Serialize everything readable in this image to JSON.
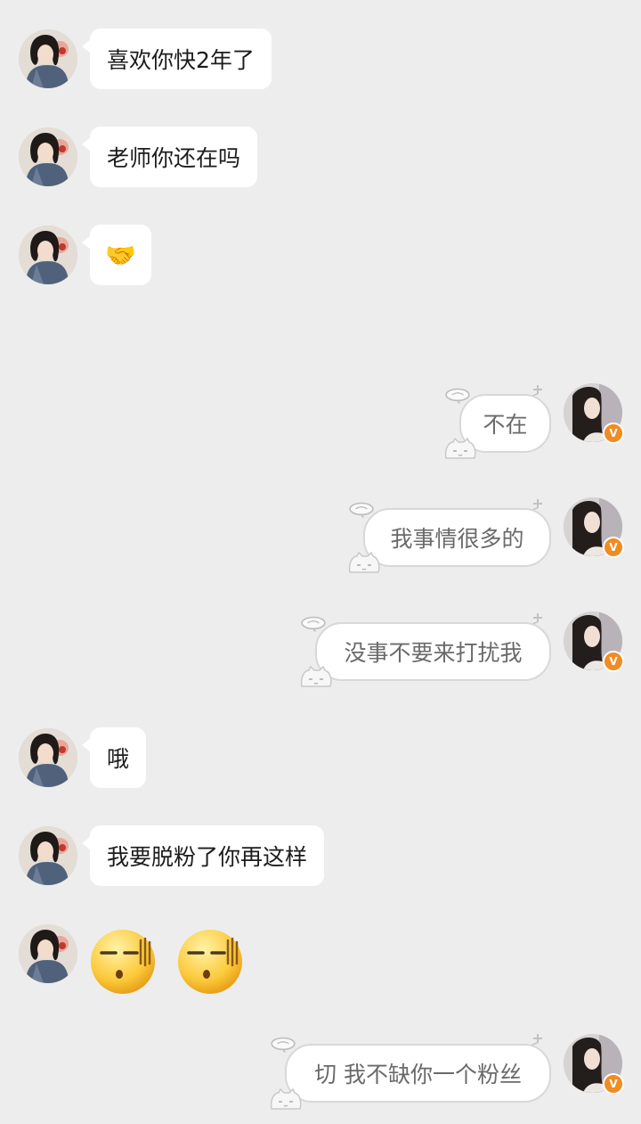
{
  "conversation": {
    "messages": [
      {
        "sender": "other",
        "text": "喜欢你快2年了"
      },
      {
        "sender": "other",
        "text": "老师你还在吗"
      },
      {
        "sender": "other",
        "emoji": "handshake",
        "text": "🤝"
      },
      {
        "sender": "me",
        "text": "不在"
      },
      {
        "sender": "me",
        "text": "我事情很多的"
      },
      {
        "sender": "me",
        "text": "没事不要来打扰我"
      },
      {
        "sender": "other",
        "text": "哦"
      },
      {
        "sender": "other",
        "text": "我要脱粉了你再这样"
      },
      {
        "sender": "other",
        "emoji": [
          "awkward-sweat-face",
          "awkward-sweat-face"
        ]
      },
      {
        "sender": "me",
        "text": "切 我不缺你一个粉丝"
      }
    ]
  },
  "badges": {
    "verified": "V"
  },
  "colors": {
    "background": "#ededed",
    "incoming_bubble": "#ffffff",
    "outgoing_border": "#d8d8d8",
    "verified_badge": "#f08c23"
  }
}
